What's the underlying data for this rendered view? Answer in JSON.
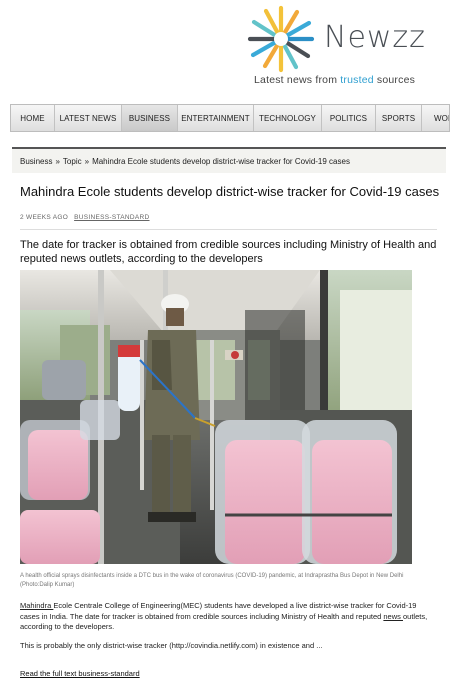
{
  "brand": {
    "name": "Newzz",
    "tagline_pre": "Latest news from ",
    "tagline_hl": "trusted",
    "tagline_post": " sources",
    "accent_color": "#2f9fd0"
  },
  "nav": {
    "items": [
      {
        "label": "HOME",
        "active": false
      },
      {
        "label": "LATEST NEWS",
        "active": false
      },
      {
        "label": "BUSINESS",
        "active": true
      },
      {
        "label": "ENTERTAINMENT",
        "active": false
      },
      {
        "label": "TECHNOLOGY",
        "active": false
      },
      {
        "label": "POLITICS",
        "active": false
      },
      {
        "label": "SPORTS",
        "active": false
      },
      {
        "label": "WORLD",
        "active": false
      }
    ]
  },
  "breadcrumb": {
    "items": [
      "Business",
      "Topic",
      "Mahindra Ecole students develop district-wise tracker for Covid-19 cases"
    ],
    "separator": "»"
  },
  "article": {
    "title": "Mahindra Ecole students develop district-wise tracker for Covid-19 cases",
    "time_ago": "2 WEEKS AGO",
    "source": "BUSINESS-STANDARD",
    "subtitle": "The date for tracker is obtained from credible sources including Ministry of Health and reputed news outlets, according to the developers",
    "caption": "A health official sprays disinfectants inside a DTC bus in the wake of coronavirus (COVID-19) pandemic, at Indraprastha Bus Depot in New Delhi (Photo:Dalip Kumar)",
    "para1_link": "Mahindra ",
    "para1_a": "Ecole Centrale College of Engineering(MEC) students have developed a live district-wise tracker for Covid-19 cases in India. The date for tracker is obtained from credible sources including Ministry of Health and reputed ",
    "para1_link2": "news ",
    "para1_b": "outlets, according to the developers.",
    "para2": "This is probably the only district-wise tracker (http://covindia.netlify.com) in existence and ...",
    "read_more": "Read the full text business-standard"
  }
}
